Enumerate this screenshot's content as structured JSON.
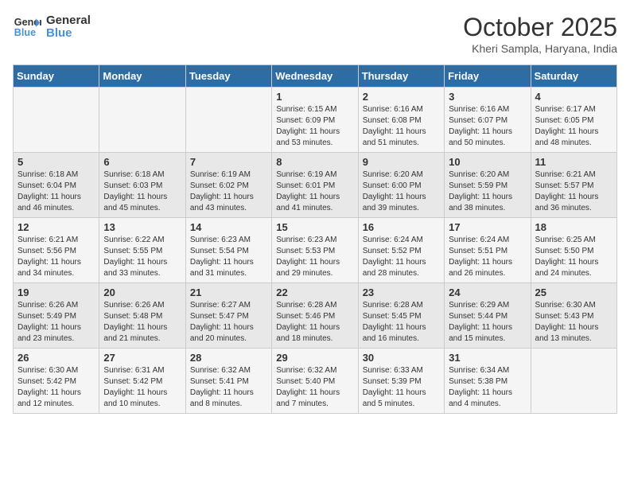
{
  "header": {
    "logo_line1": "General",
    "logo_line2": "Blue",
    "month_title": "October 2025",
    "location": "Kheri Sampla, Haryana, India"
  },
  "weekdays": [
    "Sunday",
    "Monday",
    "Tuesday",
    "Wednesday",
    "Thursday",
    "Friday",
    "Saturday"
  ],
  "weeks": [
    [
      {
        "day": "",
        "info": ""
      },
      {
        "day": "",
        "info": ""
      },
      {
        "day": "",
        "info": ""
      },
      {
        "day": "1",
        "info": "Sunrise: 6:15 AM\nSunset: 6:09 PM\nDaylight: 11 hours and 53 minutes."
      },
      {
        "day": "2",
        "info": "Sunrise: 6:16 AM\nSunset: 6:08 PM\nDaylight: 11 hours and 51 minutes."
      },
      {
        "day": "3",
        "info": "Sunrise: 6:16 AM\nSunset: 6:07 PM\nDaylight: 11 hours and 50 minutes."
      },
      {
        "day": "4",
        "info": "Sunrise: 6:17 AM\nSunset: 6:05 PM\nDaylight: 11 hours and 48 minutes."
      }
    ],
    [
      {
        "day": "5",
        "info": "Sunrise: 6:18 AM\nSunset: 6:04 PM\nDaylight: 11 hours and 46 minutes."
      },
      {
        "day": "6",
        "info": "Sunrise: 6:18 AM\nSunset: 6:03 PM\nDaylight: 11 hours and 45 minutes."
      },
      {
        "day": "7",
        "info": "Sunrise: 6:19 AM\nSunset: 6:02 PM\nDaylight: 11 hours and 43 minutes."
      },
      {
        "day": "8",
        "info": "Sunrise: 6:19 AM\nSunset: 6:01 PM\nDaylight: 11 hours and 41 minutes."
      },
      {
        "day": "9",
        "info": "Sunrise: 6:20 AM\nSunset: 6:00 PM\nDaylight: 11 hours and 39 minutes."
      },
      {
        "day": "10",
        "info": "Sunrise: 6:20 AM\nSunset: 5:59 PM\nDaylight: 11 hours and 38 minutes."
      },
      {
        "day": "11",
        "info": "Sunrise: 6:21 AM\nSunset: 5:57 PM\nDaylight: 11 hours and 36 minutes."
      }
    ],
    [
      {
        "day": "12",
        "info": "Sunrise: 6:21 AM\nSunset: 5:56 PM\nDaylight: 11 hours and 34 minutes."
      },
      {
        "day": "13",
        "info": "Sunrise: 6:22 AM\nSunset: 5:55 PM\nDaylight: 11 hours and 33 minutes."
      },
      {
        "day": "14",
        "info": "Sunrise: 6:23 AM\nSunset: 5:54 PM\nDaylight: 11 hours and 31 minutes."
      },
      {
        "day": "15",
        "info": "Sunrise: 6:23 AM\nSunset: 5:53 PM\nDaylight: 11 hours and 29 minutes."
      },
      {
        "day": "16",
        "info": "Sunrise: 6:24 AM\nSunset: 5:52 PM\nDaylight: 11 hours and 28 minutes."
      },
      {
        "day": "17",
        "info": "Sunrise: 6:24 AM\nSunset: 5:51 PM\nDaylight: 11 hours and 26 minutes."
      },
      {
        "day": "18",
        "info": "Sunrise: 6:25 AM\nSunset: 5:50 PM\nDaylight: 11 hours and 24 minutes."
      }
    ],
    [
      {
        "day": "19",
        "info": "Sunrise: 6:26 AM\nSunset: 5:49 PM\nDaylight: 11 hours and 23 minutes."
      },
      {
        "day": "20",
        "info": "Sunrise: 6:26 AM\nSunset: 5:48 PM\nDaylight: 11 hours and 21 minutes."
      },
      {
        "day": "21",
        "info": "Sunrise: 6:27 AM\nSunset: 5:47 PM\nDaylight: 11 hours and 20 minutes."
      },
      {
        "day": "22",
        "info": "Sunrise: 6:28 AM\nSunset: 5:46 PM\nDaylight: 11 hours and 18 minutes."
      },
      {
        "day": "23",
        "info": "Sunrise: 6:28 AM\nSunset: 5:45 PM\nDaylight: 11 hours and 16 minutes."
      },
      {
        "day": "24",
        "info": "Sunrise: 6:29 AM\nSunset: 5:44 PM\nDaylight: 11 hours and 15 minutes."
      },
      {
        "day": "25",
        "info": "Sunrise: 6:30 AM\nSunset: 5:43 PM\nDaylight: 11 hours and 13 minutes."
      }
    ],
    [
      {
        "day": "26",
        "info": "Sunrise: 6:30 AM\nSunset: 5:42 PM\nDaylight: 11 hours and 12 minutes."
      },
      {
        "day": "27",
        "info": "Sunrise: 6:31 AM\nSunset: 5:42 PM\nDaylight: 11 hours and 10 minutes."
      },
      {
        "day": "28",
        "info": "Sunrise: 6:32 AM\nSunset: 5:41 PM\nDaylight: 11 hours and 8 minutes."
      },
      {
        "day": "29",
        "info": "Sunrise: 6:32 AM\nSunset: 5:40 PM\nDaylight: 11 hours and 7 minutes."
      },
      {
        "day": "30",
        "info": "Sunrise: 6:33 AM\nSunset: 5:39 PM\nDaylight: 11 hours and 5 minutes."
      },
      {
        "day": "31",
        "info": "Sunrise: 6:34 AM\nSunset: 5:38 PM\nDaylight: 11 hours and 4 minutes."
      },
      {
        "day": "",
        "info": ""
      }
    ]
  ]
}
